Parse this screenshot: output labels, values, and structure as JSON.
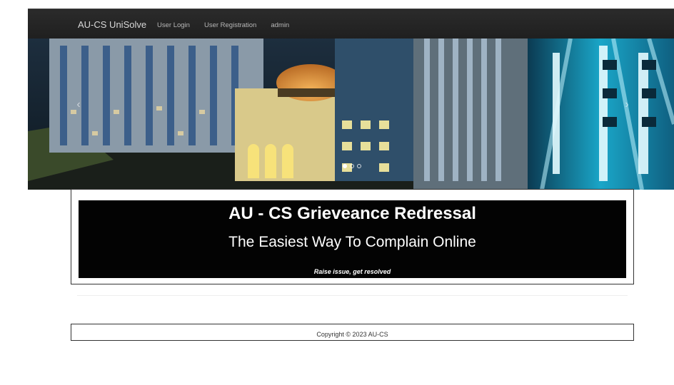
{
  "navbar": {
    "brand": "AU-CS UniSolve",
    "links": [
      {
        "label": "User Login"
      },
      {
        "label": "User Registration"
      },
      {
        "label": "admin"
      }
    ]
  },
  "carousel": {
    "prev_symbol": "‹",
    "next_symbol": "›",
    "slide_count": 3,
    "active_index": 0
  },
  "hero": {
    "title": "AU - CS Grieveance Redressal",
    "subtitle": "The Easiest Way To Complain Online",
    "tagline": "Raise issue, get resolved"
  },
  "footer": {
    "copyright": "Copyright © 2023 AU-CS"
  },
  "colors": {
    "navbar": "#222222",
    "hero_background": "#030303",
    "hero_text": "#ffffff"
  }
}
